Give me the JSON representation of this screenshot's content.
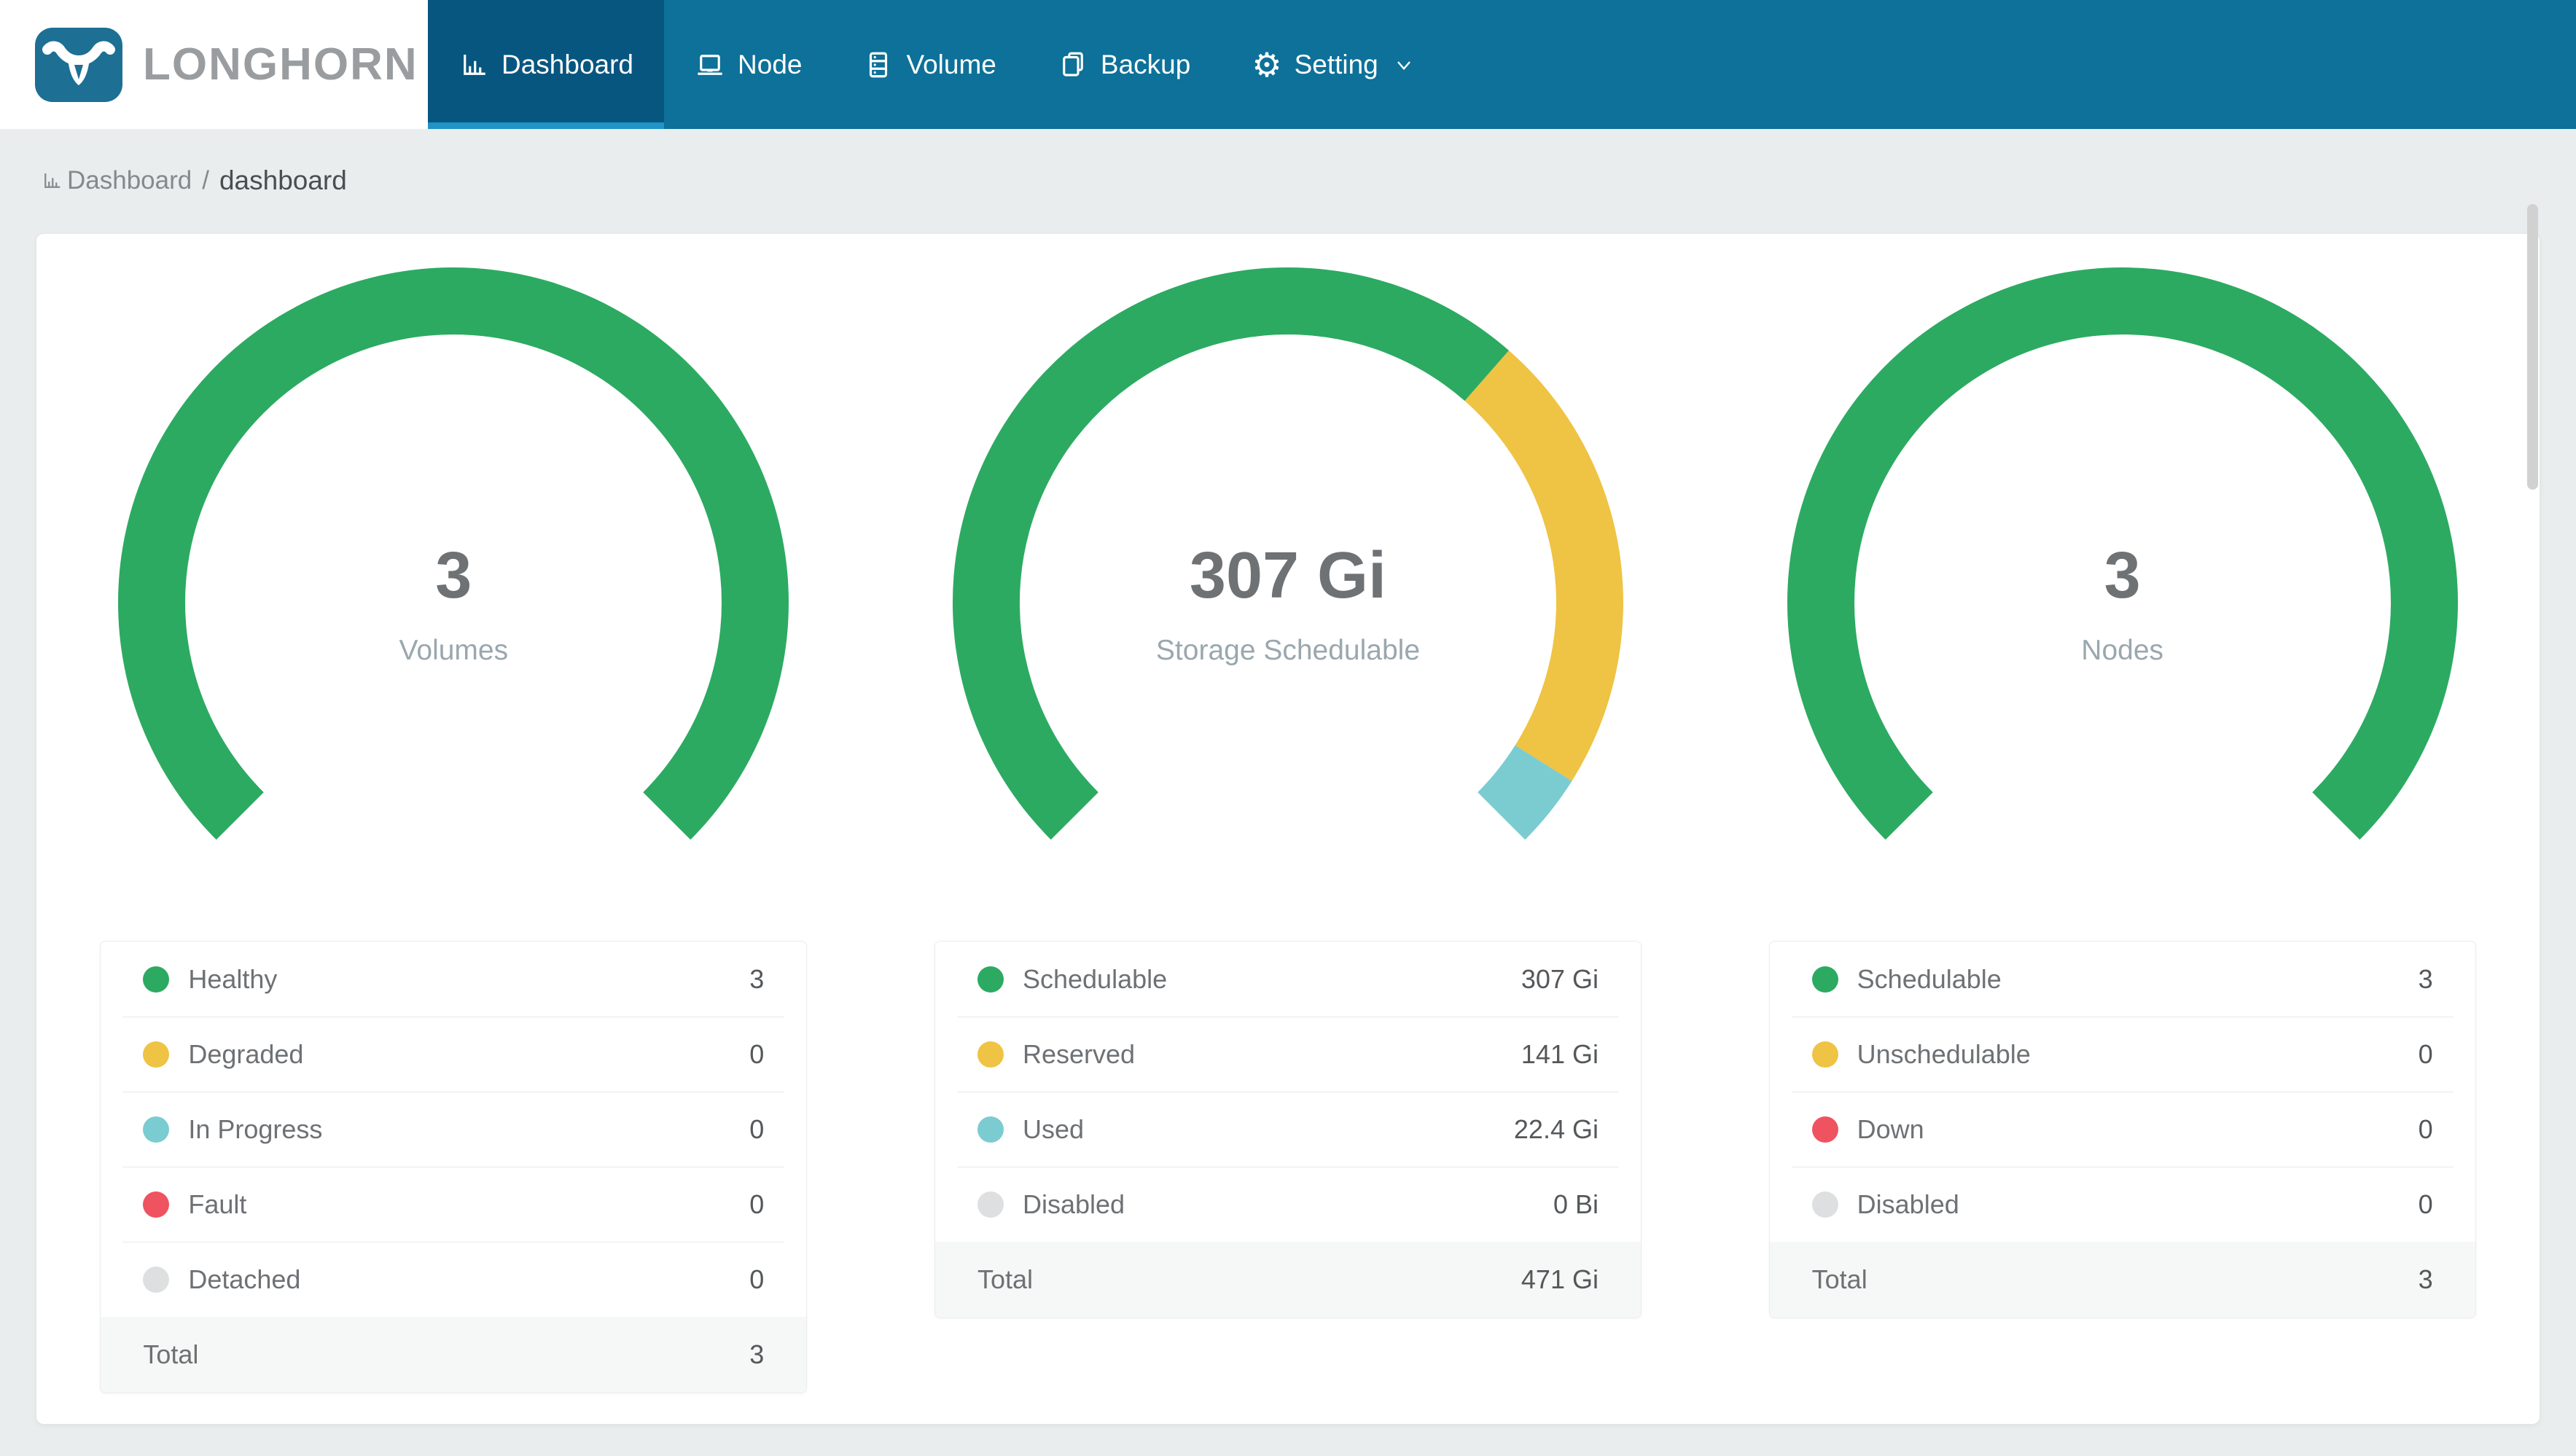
{
  "brand": {
    "name": "LONGHORN"
  },
  "theme": {
    "navbar": "#0d7199",
    "navbar_active": "#07567f",
    "navbar_underline": "#2094c4",
    "logo_blue": "#1d6f94",
    "brand_text": "#9a9da0",
    "page_bg": "#e9eded",
    "card_bg": "#ffffff",
    "total_row_bg": "#f6f7f7"
  },
  "nav": {
    "items": [
      {
        "label": "Dashboard",
        "icon": "bar-chart-icon",
        "active": true
      },
      {
        "label": "Node",
        "icon": "node-icon",
        "active": false
      },
      {
        "label": "Volume",
        "icon": "volume-icon",
        "active": false
      },
      {
        "label": "Backup",
        "icon": "backup-icon",
        "active": false
      },
      {
        "label": "Setting",
        "icon": "gear-icon",
        "active": false,
        "has_caret": true
      }
    ]
  },
  "breadcrumb": {
    "section": "Dashboard",
    "separator": "/",
    "page": "dashboard"
  },
  "chart_data": [
    {
      "type": "gauge",
      "title": "Volumes",
      "center_value": "3",
      "center_label": "Volumes",
      "arc": {
        "start_angle_deg": 225,
        "sweep_deg": 270
      },
      "segments": [
        {
          "label": "Healthy",
          "value": 3,
          "display": "3",
          "color": "#2caa62"
        },
        {
          "label": "Degraded",
          "value": 0,
          "display": "0",
          "color": "#efc343"
        },
        {
          "label": "In Progress",
          "value": 0,
          "display": "0",
          "color": "#7bccd1"
        },
        {
          "label": "Fault",
          "value": 0,
          "display": "0",
          "color": "#ef5360"
        },
        {
          "label": "Detached",
          "value": 0,
          "display": "0",
          "color": "#dddfe0"
        }
      ],
      "total": {
        "label": "Total",
        "display": "3"
      }
    },
    {
      "type": "gauge",
      "title": "Storage Schedulable",
      "center_value": "307 Gi",
      "center_label": "Storage Schedulable",
      "arc": {
        "start_angle_deg": 225,
        "sweep_deg": 270
      },
      "segments": [
        {
          "label": "Schedulable",
          "value": 307,
          "display": "307 Gi",
          "color": "#2caa62"
        },
        {
          "label": "Reserved",
          "value": 141,
          "display": "141 Gi",
          "color": "#efc343"
        },
        {
          "label": "Used",
          "value": 22.4,
          "display": "22.4 Gi",
          "color": "#7bccd1"
        },
        {
          "label": "Disabled",
          "value": 0,
          "display": "0 Bi",
          "color": "#dddfe0"
        }
      ],
      "total": {
        "label": "Total",
        "display": "471 Gi"
      }
    },
    {
      "type": "gauge",
      "title": "Nodes",
      "center_value": "3",
      "center_label": "Nodes",
      "arc": {
        "start_angle_deg": 225,
        "sweep_deg": 270
      },
      "segments": [
        {
          "label": "Schedulable",
          "value": 3,
          "display": "3",
          "color": "#2caa62"
        },
        {
          "label": "Unschedulable",
          "value": 0,
          "display": "0",
          "color": "#efc343"
        },
        {
          "label": "Down",
          "value": 0,
          "display": "0",
          "color": "#ef5360"
        },
        {
          "label": "Disabled",
          "value": 0,
          "display": "0",
          "color": "#dddfe0"
        }
      ],
      "total": {
        "label": "Total",
        "display": "3"
      }
    }
  ]
}
